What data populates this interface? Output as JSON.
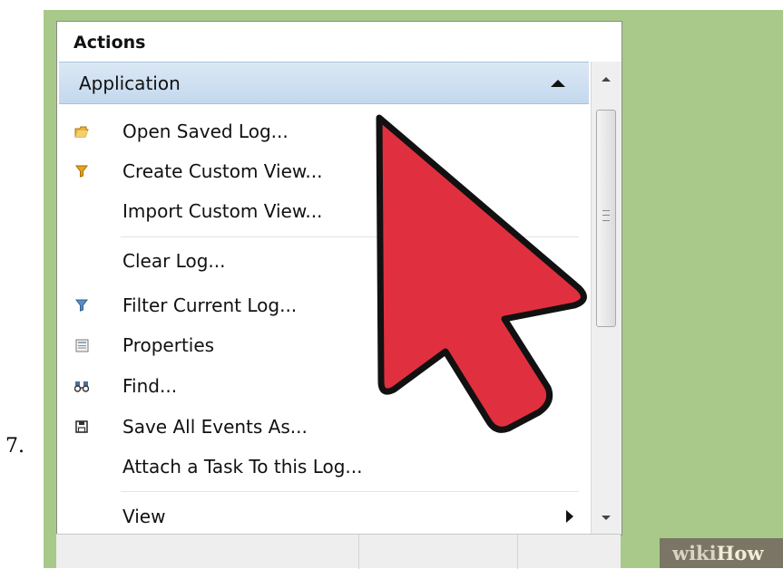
{
  "step_number": "7.",
  "panel": {
    "title": "Actions",
    "section": "Application",
    "items": [
      {
        "label": "Open Saved Log...",
        "icon": "open-folder-icon"
      },
      {
        "label": "Create Custom View...",
        "icon": "filter-icon"
      },
      {
        "label": "Import Custom View...",
        "icon": ""
      },
      {
        "label": "Clear Log...",
        "icon": ""
      },
      {
        "label": "Filter Current Log...",
        "icon": "filter-icon"
      },
      {
        "label": "Properties",
        "icon": "properties-icon"
      },
      {
        "label": "Find...",
        "icon": "binoculars-icon"
      },
      {
        "label": "Save All Events As...",
        "icon": "save-icon"
      },
      {
        "label": "Attach a Task To this Log...",
        "icon": ""
      },
      {
        "label": "View",
        "icon": "",
        "has_submenu": true
      }
    ]
  },
  "colors": {
    "frame_green": "#a8c98a",
    "arrow_red": "#e0303f",
    "section_blue": "#c4d8ed"
  },
  "watermark": {
    "part1": "wiki",
    "part2": "How"
  }
}
